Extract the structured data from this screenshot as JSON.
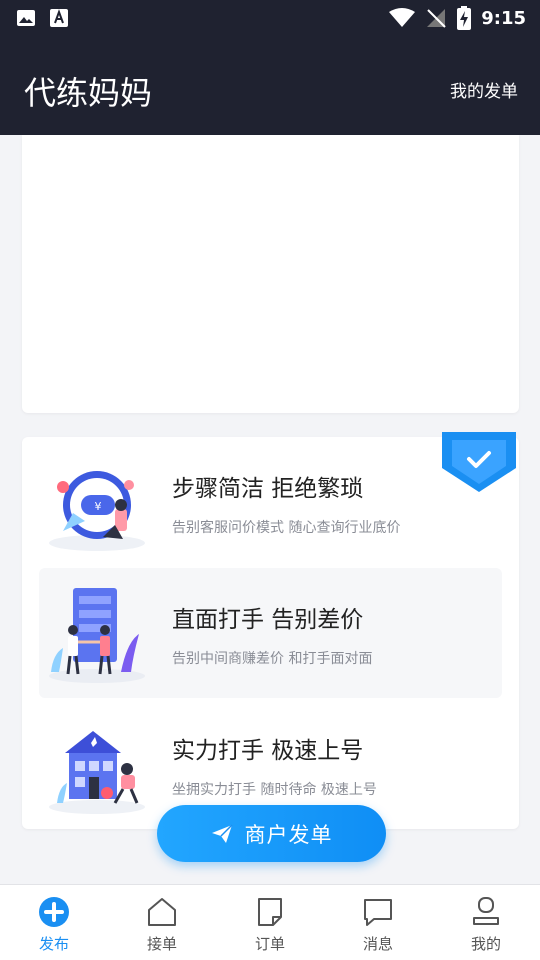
{
  "status_bar": {
    "time": "9:15",
    "icons": [
      "image-icon",
      "font-icon",
      "wifi-icon",
      "no-signal-icon",
      "battery-charging-icon"
    ]
  },
  "app_bar": {
    "title": "代练妈妈",
    "action_label": "我的发单"
  },
  "features": [
    {
      "title": "步骤简洁 拒绝繁琐",
      "subtitle": "告别客服问价模式 随心查询行业底价",
      "icon": "chat-illustration",
      "highlighted": false
    },
    {
      "title": "直面打手 告别差价",
      "subtitle": "告别中间商赚差价 和打手面对面",
      "icon": "handshake-illustration",
      "highlighted": true
    },
    {
      "title": "实力打手 极速上号",
      "subtitle": "坐拥实力打手 随时待命 极速上号",
      "icon": "house-illustration",
      "highlighted": false
    }
  ],
  "cta": {
    "label": "商户发单",
    "icon": "paper-plane-icon"
  },
  "tabs": [
    {
      "label": "发布",
      "icon": "plus-circle-icon",
      "active": true
    },
    {
      "label": "接单",
      "icon": "home-icon",
      "active": false
    },
    {
      "label": "订单",
      "icon": "note-icon",
      "active": false
    },
    {
      "label": "消息",
      "icon": "message-icon",
      "active": false
    },
    {
      "label": "我的",
      "icon": "user-icon",
      "active": false
    }
  ],
  "colors": {
    "header": "#1f2230",
    "accent": "#1a8ff2",
    "background": "#f3f4f7"
  }
}
